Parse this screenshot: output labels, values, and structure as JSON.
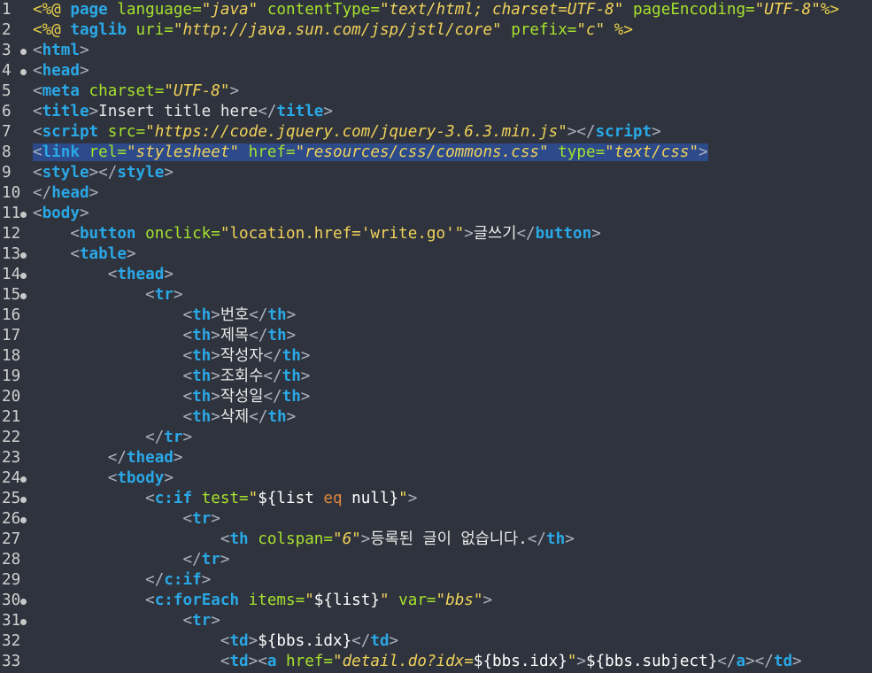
{
  "editor": {
    "lines": [
      {
        "n": "1",
        "fold": false,
        "indent": 0,
        "tokens": [
          [
            "dir",
            "<%@"
          ],
          [
            "tag",
            " page"
          ],
          [
            "attr",
            " language="
          ],
          [
            "sv",
            "\"java\""
          ],
          [
            "attr",
            " contentType="
          ],
          [
            "sv",
            "\"text/html; charset=UTF-8\""
          ],
          [
            "attr",
            " pageEncoding="
          ],
          [
            "sv",
            "\"UTF-8\""
          ],
          [
            "dir",
            "%>"
          ]
        ]
      },
      {
        "n": "2",
        "fold": false,
        "indent": 0,
        "tokens": [
          [
            "dir",
            "<%@"
          ],
          [
            "tag",
            " taglib"
          ],
          [
            "attr",
            " uri="
          ],
          [
            "sv",
            "\"http://java.sun.com/jsp/jstl/core\""
          ],
          [
            "attr",
            " prefix="
          ],
          [
            "sv",
            "\"c\""
          ],
          [
            "dir",
            " %>"
          ]
        ]
      },
      {
        "n": "3",
        "fold": true,
        "indent": 0,
        "tokens": [
          [
            "br",
            "<"
          ],
          [
            "tag",
            "html"
          ],
          [
            "br",
            ">"
          ]
        ]
      },
      {
        "n": "4",
        "fold": true,
        "indent": 0,
        "tokens": [
          [
            "br",
            "<"
          ],
          [
            "tag",
            "head"
          ],
          [
            "br",
            ">"
          ]
        ]
      },
      {
        "n": "5",
        "fold": false,
        "indent": 0,
        "tokens": [
          [
            "br",
            "<"
          ],
          [
            "tag",
            "meta"
          ],
          [
            "attr",
            " charset="
          ],
          [
            "sv",
            "\"UTF-8\""
          ],
          [
            "br",
            ">"
          ]
        ]
      },
      {
        "n": "6",
        "fold": false,
        "indent": 0,
        "tokens": [
          [
            "br",
            "<"
          ],
          [
            "tag",
            "title"
          ],
          [
            "br",
            ">"
          ],
          [
            "tx",
            "Insert title here"
          ],
          [
            "br",
            "</"
          ],
          [
            "tag",
            "title"
          ],
          [
            "br",
            ">"
          ]
        ]
      },
      {
        "n": "7",
        "fold": false,
        "indent": 0,
        "tokens": [
          [
            "br",
            "<"
          ],
          [
            "tag",
            "script"
          ],
          [
            "attr",
            " src="
          ],
          [
            "sv",
            "\"https://code.jquery.com/jquery-3.6.3.min.js\""
          ],
          [
            "br",
            "></"
          ],
          [
            "tag",
            "script"
          ],
          [
            "br",
            ">"
          ]
        ]
      },
      {
        "n": "8",
        "fold": false,
        "indent": 0,
        "selected": true,
        "tokens": [
          [
            "br",
            "<"
          ],
          [
            "tag",
            "link"
          ],
          [
            "attr",
            " rel="
          ],
          [
            "sv",
            "\"stylesheet\""
          ],
          [
            "attr",
            " href="
          ],
          [
            "sv",
            "\"resources/css/commons.css\""
          ],
          [
            "attr",
            " type="
          ],
          [
            "sv",
            "\"text/css\""
          ],
          [
            "br",
            ">"
          ]
        ]
      },
      {
        "n": "9",
        "fold": false,
        "indent": 0,
        "tokens": [
          [
            "br",
            "<"
          ],
          [
            "tag",
            "style"
          ],
          [
            "br",
            "></"
          ],
          [
            "tag",
            "style"
          ],
          [
            "br",
            ">"
          ]
        ]
      },
      {
        "n": "10",
        "fold": false,
        "indent": 0,
        "tokens": [
          [
            "br",
            "</"
          ],
          [
            "tag",
            "head"
          ],
          [
            "br",
            ">"
          ]
        ]
      },
      {
        "n": "11",
        "fold": true,
        "indent": 0,
        "tokens": [
          [
            "br",
            "<"
          ],
          [
            "tag",
            "body"
          ],
          [
            "br",
            ">"
          ]
        ]
      },
      {
        "n": "12",
        "fold": false,
        "indent": 1,
        "tokens": [
          [
            "br",
            "<"
          ],
          [
            "tag",
            "button"
          ],
          [
            "attr",
            " onclick="
          ],
          [
            "s",
            "\"location.href='write.go'\""
          ],
          [
            "br",
            ">"
          ],
          [
            "tx",
            "글쓰기"
          ],
          [
            "br",
            "</"
          ],
          [
            "tag",
            "button"
          ],
          [
            "br",
            ">"
          ]
        ]
      },
      {
        "n": "13",
        "fold": true,
        "indent": 1,
        "tokens": [
          [
            "br",
            "<"
          ],
          [
            "tag",
            "table"
          ],
          [
            "br",
            ">"
          ]
        ]
      },
      {
        "n": "14",
        "fold": true,
        "indent": 2,
        "tokens": [
          [
            "br",
            "<"
          ],
          [
            "tag",
            "thead"
          ],
          [
            "br",
            ">"
          ]
        ]
      },
      {
        "n": "15",
        "fold": true,
        "indent": 3,
        "tokens": [
          [
            "br",
            "<"
          ],
          [
            "tag",
            "tr"
          ],
          [
            "br",
            ">"
          ]
        ]
      },
      {
        "n": "16",
        "fold": false,
        "indent": 4,
        "tokens": [
          [
            "br",
            "<"
          ],
          [
            "tag",
            "th"
          ],
          [
            "br",
            ">"
          ],
          [
            "tx",
            "번호"
          ],
          [
            "br",
            "</"
          ],
          [
            "tag",
            "th"
          ],
          [
            "br",
            ">"
          ]
        ]
      },
      {
        "n": "17",
        "fold": false,
        "indent": 4,
        "tokens": [
          [
            "br",
            "<"
          ],
          [
            "tag",
            "th"
          ],
          [
            "br",
            ">"
          ],
          [
            "tx",
            "제목"
          ],
          [
            "br",
            "</"
          ],
          [
            "tag",
            "th"
          ],
          [
            "br",
            ">"
          ]
        ]
      },
      {
        "n": "18",
        "fold": false,
        "indent": 4,
        "tokens": [
          [
            "br",
            "<"
          ],
          [
            "tag",
            "th"
          ],
          [
            "br",
            ">"
          ],
          [
            "tx",
            "작성자"
          ],
          [
            "br",
            "</"
          ],
          [
            "tag",
            "th"
          ],
          [
            "br",
            ">"
          ]
        ]
      },
      {
        "n": "19",
        "fold": false,
        "indent": 4,
        "tokens": [
          [
            "br",
            "<"
          ],
          [
            "tag",
            "th"
          ],
          [
            "br",
            ">"
          ],
          [
            "tx",
            "조회수"
          ],
          [
            "br",
            "</"
          ],
          [
            "tag",
            "th"
          ],
          [
            "br",
            ">"
          ]
        ]
      },
      {
        "n": "20",
        "fold": false,
        "indent": 4,
        "tokens": [
          [
            "br",
            "<"
          ],
          [
            "tag",
            "th"
          ],
          [
            "br",
            ">"
          ],
          [
            "tx",
            "작성일"
          ],
          [
            "br",
            "</"
          ],
          [
            "tag",
            "th"
          ],
          [
            "br",
            ">"
          ]
        ]
      },
      {
        "n": "21",
        "fold": false,
        "indent": 4,
        "tokens": [
          [
            "br",
            "<"
          ],
          [
            "tag",
            "th"
          ],
          [
            "br",
            ">"
          ],
          [
            "tx",
            "삭제"
          ],
          [
            "br",
            "</"
          ],
          [
            "tag",
            "th"
          ],
          [
            "br",
            ">"
          ]
        ]
      },
      {
        "n": "22",
        "fold": false,
        "indent": 3,
        "tokens": [
          [
            "br",
            "</"
          ],
          [
            "tag",
            "tr"
          ],
          [
            "br",
            ">"
          ]
        ]
      },
      {
        "n": "23",
        "fold": false,
        "indent": 2,
        "tokens": [
          [
            "br",
            "</"
          ],
          [
            "tag",
            "thead"
          ],
          [
            "br",
            ">"
          ]
        ]
      },
      {
        "n": "24",
        "fold": true,
        "indent": 2,
        "tokens": [
          [
            "br",
            "<"
          ],
          [
            "tag",
            "tbody"
          ],
          [
            "br",
            ">"
          ]
        ]
      },
      {
        "n": "25",
        "fold": true,
        "indent": 3,
        "tokens": [
          [
            "br",
            "<"
          ],
          [
            "tag",
            "c:if"
          ],
          [
            "attr",
            " test="
          ],
          [
            "s",
            "\""
          ],
          [
            "el",
            "${list "
          ],
          [
            "op",
            "eq"
          ],
          [
            "el",
            " null}"
          ],
          [
            "s",
            "\""
          ],
          [
            "br",
            ">"
          ]
        ]
      },
      {
        "n": "26",
        "fold": true,
        "indent": 4,
        "tokens": [
          [
            "br",
            "<"
          ],
          [
            "tag",
            "tr"
          ],
          [
            "br",
            ">"
          ]
        ]
      },
      {
        "n": "27",
        "fold": false,
        "indent": 5,
        "tokens": [
          [
            "br",
            "<"
          ],
          [
            "tag",
            "th"
          ],
          [
            "attr",
            " colspan="
          ],
          [
            "sv",
            "\"6\""
          ],
          [
            "br",
            ">"
          ],
          [
            "tx",
            "등록된 글이 없습니다."
          ],
          [
            "br",
            "</"
          ],
          [
            "tag",
            "th"
          ],
          [
            "br",
            ">"
          ]
        ]
      },
      {
        "n": "28",
        "fold": false,
        "indent": 4,
        "tokens": [
          [
            "br",
            "</"
          ],
          [
            "tag",
            "tr"
          ],
          [
            "br",
            ">"
          ]
        ]
      },
      {
        "n": "29",
        "fold": false,
        "indent": 3,
        "tokens": [
          [
            "br",
            "</"
          ],
          [
            "tag",
            "c:if"
          ],
          [
            "br",
            ">"
          ]
        ]
      },
      {
        "n": "30",
        "fold": true,
        "indent": 3,
        "tokens": [
          [
            "br",
            "<"
          ],
          [
            "tag",
            "c:forEach"
          ],
          [
            "attr",
            " items="
          ],
          [
            "s",
            "\""
          ],
          [
            "el",
            "${list}"
          ],
          [
            "s",
            "\""
          ],
          [
            "attr",
            " var="
          ],
          [
            "sv",
            "\"bbs\""
          ],
          [
            "br",
            ">"
          ]
        ]
      },
      {
        "n": "31",
        "fold": true,
        "indent": 4,
        "tokens": [
          [
            "br",
            "<"
          ],
          [
            "tag",
            "tr"
          ],
          [
            "br",
            ">"
          ]
        ]
      },
      {
        "n": "32",
        "fold": false,
        "indent": 5,
        "tokens": [
          [
            "br",
            "<"
          ],
          [
            "tag",
            "td"
          ],
          [
            "br",
            ">"
          ],
          [
            "el",
            "${bbs.idx}"
          ],
          [
            "br",
            "</"
          ],
          [
            "tag",
            "td"
          ],
          [
            "br",
            ">"
          ]
        ]
      },
      {
        "n": "33",
        "fold": false,
        "indent": 5,
        "tokens": [
          [
            "br",
            "<"
          ],
          [
            "tag",
            "td"
          ],
          [
            "br",
            "><"
          ],
          [
            "tag",
            "a"
          ],
          [
            "attr",
            " href="
          ],
          [
            "sv",
            "\"detail.do?idx="
          ],
          [
            "el",
            "${bbs.idx}"
          ],
          [
            "sv",
            "\""
          ],
          [
            "br",
            ">"
          ],
          [
            "el",
            "${bbs.subject}"
          ],
          [
            "br",
            "</"
          ],
          [
            "tag",
            "a"
          ],
          [
            "br",
            "></"
          ],
          [
            "tag",
            "td"
          ],
          [
            "br",
            ">"
          ]
        ]
      }
    ]
  }
}
